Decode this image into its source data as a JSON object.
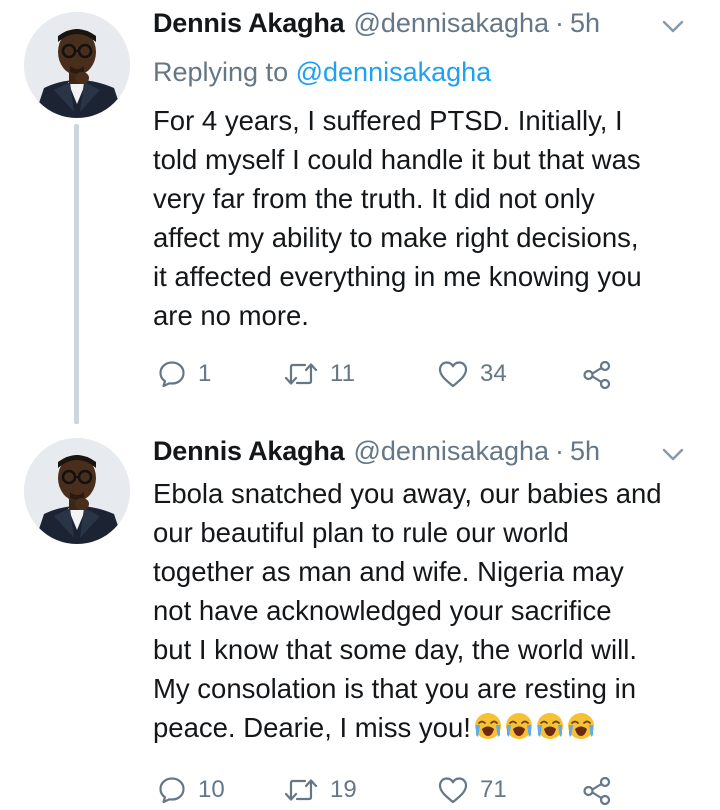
{
  "tweets": [
    {
      "author": {
        "name": "Dennis Akagha",
        "handle": "@dennisakagha"
      },
      "time_separator": "·",
      "time": "5h",
      "replying_to": {
        "prefix": "Replying to",
        "mention": "@dennisakagha"
      },
      "text_lines": [
        "For 4 years, I suffered PTSD. Initially, I",
        "told myself I could handle it but that was",
        "very far from the truth. It did not only",
        "affect my ability to make right decisions,",
        "it affected everything in me knowing you",
        "are no more."
      ],
      "stats": {
        "replies": "1",
        "retweets": "11",
        "likes": "34"
      }
    },
    {
      "author": {
        "name": "Dennis Akagha",
        "handle": "@dennisakagha"
      },
      "time_separator": "·",
      "time": "5h",
      "text_lines": [
        "Ebola snatched you away, our babies and",
        "our beautiful plan to rule our world",
        "together as man and wife. Nigeria may",
        "not have acknowledged your sacrifice",
        "but I know that some day, the world will.",
        "My consolation is that you are resting in",
        "peace. Dearie, I miss you!"
      ],
      "emojis": [
        "loudly-crying-face-emoji",
        "loudly-crying-face-emoji",
        "loudly-crying-face-emoji",
        "loudly-crying-face-emoji"
      ],
      "stats": {
        "replies": "10",
        "retweets": "19",
        "likes": "71"
      }
    }
  ],
  "icons": {
    "reply": "speech-bubble-icon",
    "retweet": "retweet-arrows-icon",
    "like": "heart-outline-icon",
    "share": "share-nodes-icon",
    "menu": "chevron-down-icon"
  },
  "colors": {
    "text": "#14171a",
    "secondary": "#657786",
    "link": "#1da1f2",
    "thread_line": "#ccd6dd",
    "background": "#ffffff"
  }
}
